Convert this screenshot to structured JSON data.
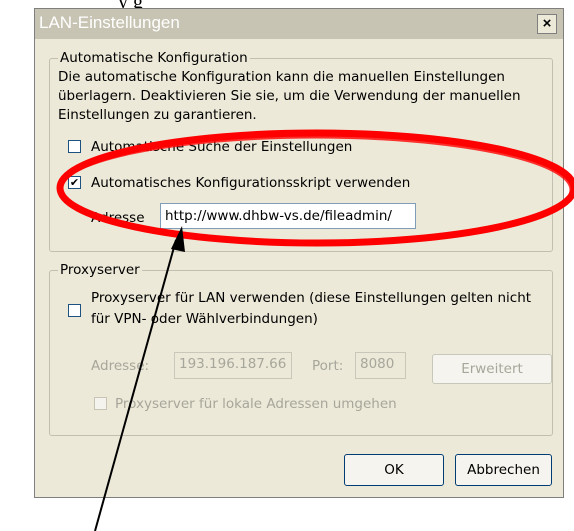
{
  "top_text": "y             g",
  "window": {
    "title": "LAN-Einstellungen",
    "close_label": "×"
  },
  "auto_config": {
    "legend": "Automatische Konfiguration",
    "description": [
      "Die automatische Konfiguration kann die manuellen Einstellungen",
      "überlagern. Deaktivieren Sie sie, um die Verwendung der manuellen",
      "Einstellungen zu garantieren."
    ],
    "auto_detect": {
      "label": "Automatische Suche der Einstellungen",
      "checked": false
    },
    "use_script": {
      "label": "Automatisches Konfigurationsskript verwenden",
      "checked": true
    },
    "address_label": "Adresse",
    "address_value": "http://www.dhbw-vs.de/fileadmin/"
  },
  "proxy": {
    "legend": "Proxyserver",
    "use_proxy": {
      "label_line1": "Proxyserver für LAN verwenden (diese Einstellungen gelten nicht",
      "label_line2": "für VPN- oder Wählverbindungen)",
      "checked": false
    },
    "address_label": "Adresse:",
    "address_value": "193.196.187.66",
    "port_label": "Port:",
    "port_value": "8080",
    "advanced_label": "Erweitert",
    "bypass_local": {
      "label": "Proxyserver für lokale Adressen umgehen",
      "checked": false
    }
  },
  "buttons": {
    "ok": "OK",
    "cancel": "Abbrechen"
  },
  "annotation": {
    "ellipse_color": "#ff0000",
    "arrow_color": "#000000"
  }
}
